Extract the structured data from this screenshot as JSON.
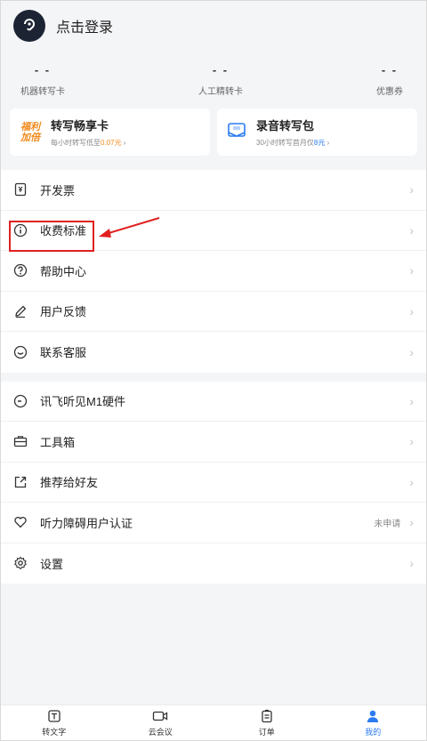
{
  "header": {
    "login_label": "点击登录",
    "avatar_icon": "ear-logo-icon"
  },
  "stats": [
    {
      "value": "- -",
      "label": "机器转写卡"
    },
    {
      "value": "- -",
      "label": "人工精转卡"
    },
    {
      "value": "- -",
      "label": "优惠券"
    }
  ],
  "cards": [
    {
      "badge_line1": "福利",
      "badge_line2": "加倍",
      "title": "转写畅享卡",
      "sub_prefix": "每小时转写低至",
      "sub_highlight": "0.07元",
      "sub_suffix": ""
    },
    {
      "badge_icon": "audio-package-icon",
      "title": "录音转写包",
      "sub_prefix": "30小时转写首月仅",
      "sub_highlight": "8元",
      "sub_suffix": ""
    }
  ],
  "menu1": [
    {
      "label": "开发票",
      "icon": "invoice-icon"
    },
    {
      "label": "收费标准",
      "icon": "info-icon"
    },
    {
      "label": "帮助中心",
      "icon": "help-icon"
    },
    {
      "label": "用户反馈",
      "icon": "pencil-icon"
    },
    {
      "label": "联系客服",
      "icon": "chat-icon"
    }
  ],
  "menu2": [
    {
      "label": "讯飞听见M1硬件",
      "icon": "device-icon",
      "extra": ""
    },
    {
      "label": "工具箱",
      "icon": "toolbox-icon",
      "extra": ""
    },
    {
      "label": "推荐给好友",
      "icon": "share-icon",
      "extra": ""
    },
    {
      "label": "听力障碍用户认证",
      "icon": "heart-icon",
      "extra": "未申请"
    },
    {
      "label": "设置",
      "icon": "gear-icon",
      "extra": ""
    }
  ],
  "chevron": "›",
  "tabs": [
    {
      "label": "转文字",
      "icon": "text-icon",
      "active": false
    },
    {
      "label": "云会议",
      "icon": "video-icon",
      "active": false
    },
    {
      "label": "订单",
      "icon": "order-icon",
      "active": false
    },
    {
      "label": "我的",
      "icon": "user-icon",
      "active": true
    }
  ],
  "colors": {
    "accent": "#2a7bf2",
    "orange": "#f08a1c",
    "highlight_red": "#e02020"
  }
}
